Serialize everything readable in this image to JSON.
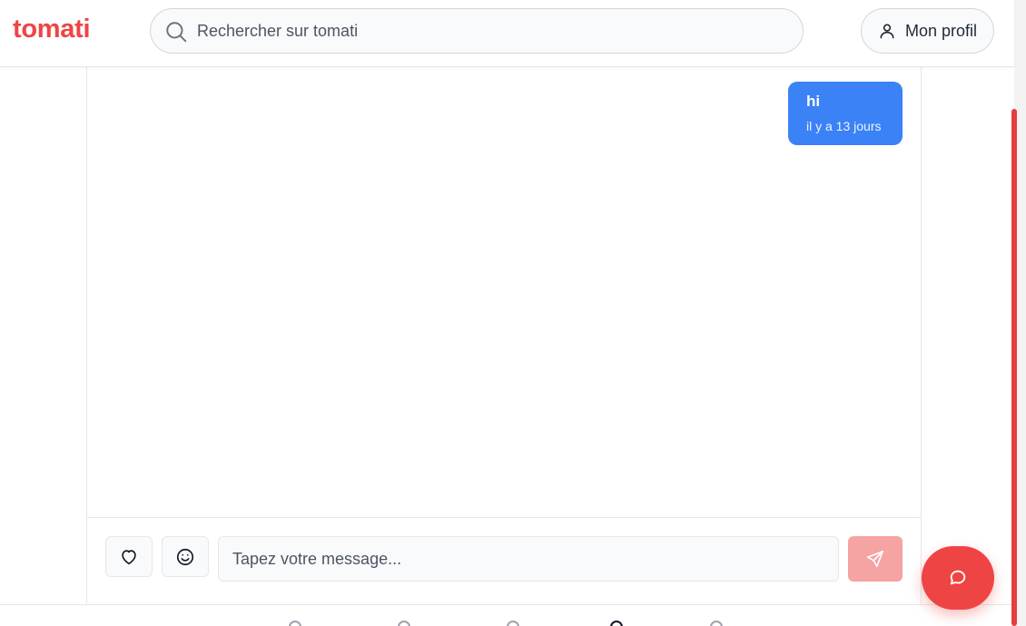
{
  "header": {
    "logo": "tomati",
    "search_placeholder": "Rechercher sur tomati",
    "profile_label": "Mon profil"
  },
  "messages": [
    {
      "text": "hi",
      "time": "il y a 13 jours",
      "sender": "me"
    }
  ],
  "composer": {
    "placeholder": "Tapez votre message..."
  },
  "icons": {
    "search": "search-icon",
    "profile": "user-icon",
    "like": "heart-icon",
    "emoji": "smile-icon",
    "send": "send-icon",
    "fab": "chat-bubble-icon"
  },
  "colors": {
    "brand": "#ef4444",
    "bubble": "#3b82f6",
    "send_disabled": "#f5a3a3"
  }
}
